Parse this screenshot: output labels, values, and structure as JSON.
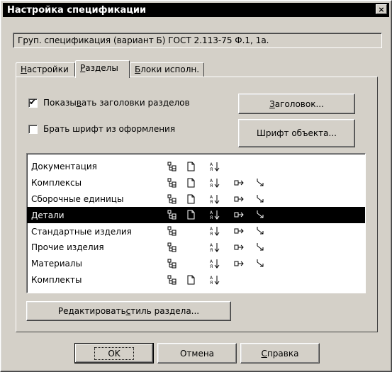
{
  "window": {
    "title": "Настройка спецификации",
    "close_glyph": "×"
  },
  "spec_name": "Груп. спецификация (вариант Б) ГОСТ 2.113-75 Ф.1, 1а.",
  "tabs": [
    {
      "pre": "",
      "accel": "Н",
      "post": "астройки"
    },
    {
      "pre": "",
      "accel": "Р",
      "post": "азделы"
    },
    {
      "pre": "",
      "accel": "Б",
      "post": "локи исполн."
    }
  ],
  "options": {
    "show_headers": {
      "pre": "Показы",
      "accel": "в",
      "post": "ать заголовки разделов",
      "checked": true,
      "check_glyph": "✔"
    },
    "font_from_design": {
      "label": "Брать шрифт из оформления",
      "checked": false
    }
  },
  "buttons": {
    "header": {
      "pre": "",
      "accel": "З",
      "post": "аголовок..."
    },
    "object_font": {
      "label": "Шрифт объекта..."
    },
    "edit_style": {
      "pre": "Редактировать ",
      "accel": "с",
      "post": "тиль раздела..."
    },
    "ok": {
      "label": "OK"
    },
    "cancel": {
      "label": "Отмена"
    },
    "help": {
      "pre": "",
      "accel": "С",
      "post": "правка"
    }
  },
  "sections": [
    {
      "name": "Документация",
      "icons": [
        "tree-icon",
        "page-icon",
        "sort-icon"
      ],
      "selected": false
    },
    {
      "name": "Комплексы",
      "icons": [
        "tree-icon",
        "page-icon",
        "sort-icon",
        "insert-icon",
        "arrow-icon"
      ],
      "selected": false
    },
    {
      "name": "Сборочные единицы",
      "icons": [
        "tree-icon",
        "page-icon",
        "sort-icon",
        "insert-icon",
        "arrow-icon"
      ],
      "selected": false
    },
    {
      "name": "Детали",
      "icons": [
        "tree-icon",
        "page-icon",
        "sort-icon",
        "insert-icon",
        "arrow-icon"
      ],
      "selected": true
    },
    {
      "name": "Стандартные изделия",
      "icons": [
        "tree-icon",
        "",
        "sort-icon",
        "insert-icon",
        "arrow-icon"
      ],
      "selected": false
    },
    {
      "name": "Прочие изделия",
      "icons": [
        "tree-icon",
        "",
        "sort-icon",
        "insert-icon",
        "arrow-icon"
      ],
      "selected": false
    },
    {
      "name": "Материалы",
      "icons": [
        "tree-icon",
        "",
        "sort-icon",
        "insert-icon",
        "arrow-icon"
      ],
      "selected": false
    },
    {
      "name": "Комплекты",
      "icons": [
        "tree-icon",
        "page-icon",
        "sort-icon"
      ],
      "selected": false
    }
  ]
}
